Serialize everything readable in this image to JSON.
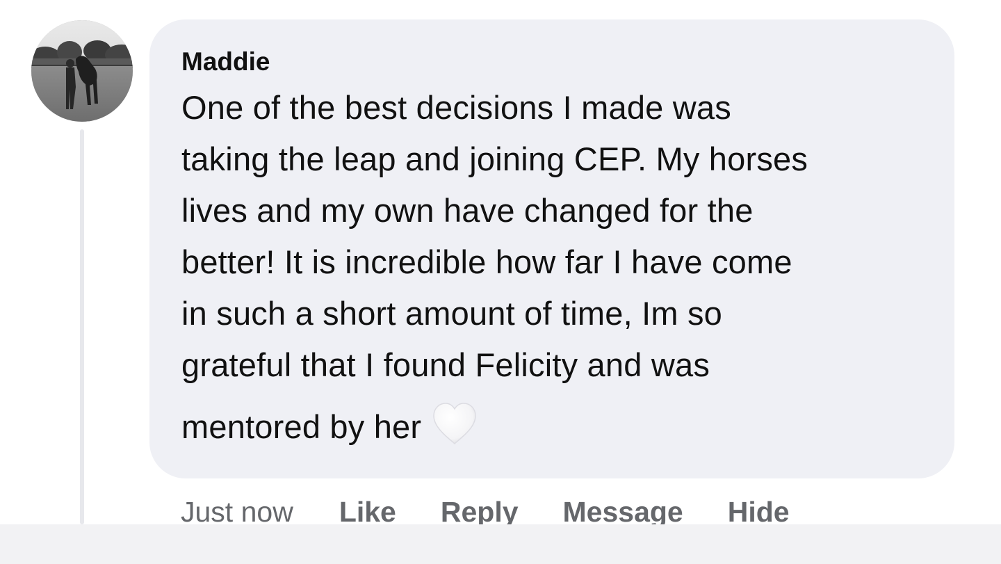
{
  "comment": {
    "author": "Maddie",
    "text_lines": [
      "One of the best decisions I made was",
      "taking the leap and joining CEP. My horses",
      "lives and my own have changed for the",
      "better! It is incredible how far I have come",
      "in such a short amount of time, Im so",
      "grateful that I found Felicity and was",
      "mentored by her"
    ],
    "emoji": "white-heart-icon"
  },
  "actions": {
    "timestamp": "Just now",
    "like": "Like",
    "reply": "Reply",
    "message": "Message",
    "hide": "Hide"
  },
  "colors": {
    "bubble_bg": "#eff0f5",
    "text": "#111111",
    "action_text": "#65676b",
    "thread_line": "#e7e8ec"
  }
}
